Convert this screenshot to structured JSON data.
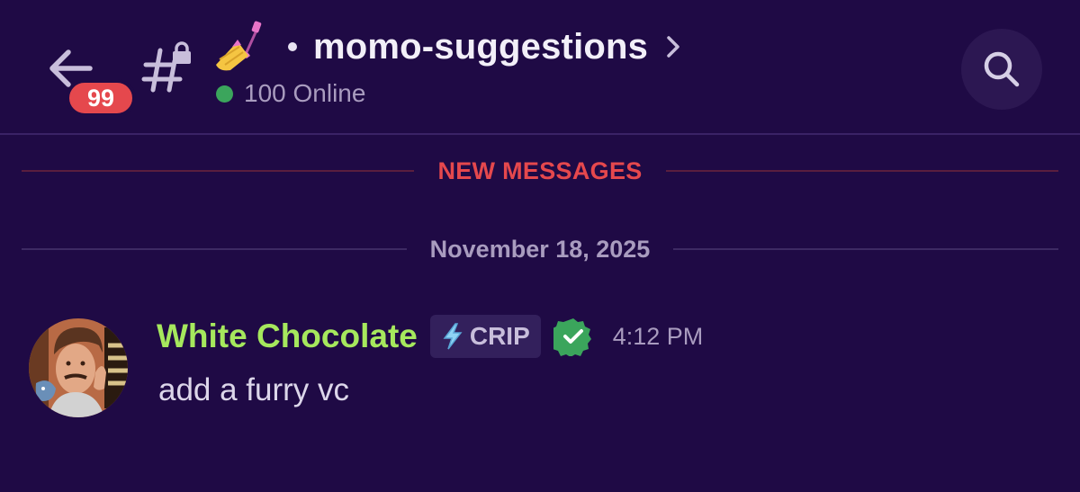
{
  "header": {
    "channel_name": "momo-suggestions",
    "online_text": "100 Online",
    "unread_count": "99",
    "channel_emoji": "nail-polish-icon",
    "icons": [
      "back-arrow-icon",
      "locked-channel-hash-icon",
      "chevron-right-icon",
      "search-icon"
    ]
  },
  "dividers": {
    "new_messages": "NEW MESSAGES",
    "date": "November 18, 2025"
  },
  "message": {
    "author": "White Chocolate",
    "tag_label": "CRIP",
    "tag_icon": "lightning-icon",
    "badge_icon": "verified-check-icon",
    "timestamp": "4:12 PM",
    "text": "add a furry vc"
  },
  "colors": {
    "background": "#1f0a45",
    "unread_badge": "#e5484d",
    "new_messages": "#e5484d",
    "username": "#a6e85d",
    "online": "#3ba55c",
    "verified": "#3ba55c"
  }
}
